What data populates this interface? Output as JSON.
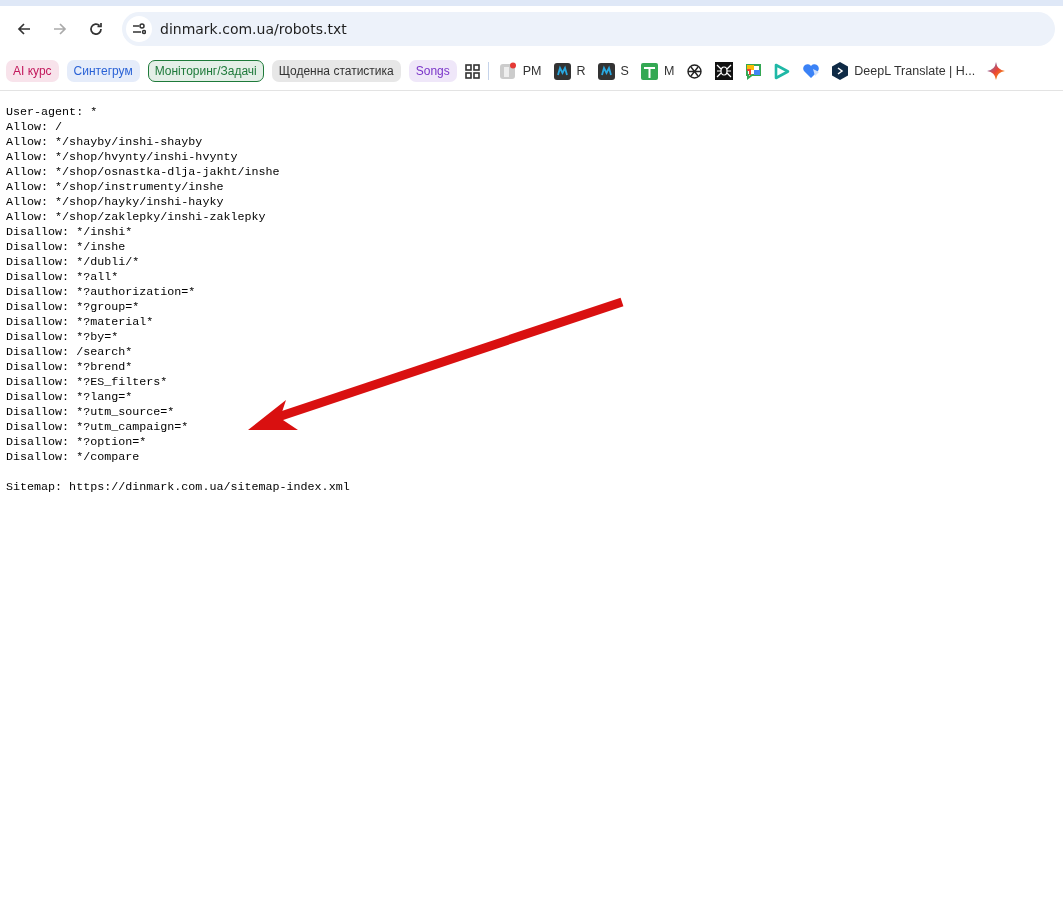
{
  "address_bar": {
    "url": "dinmark.com.ua/robots.txt"
  },
  "bookmarks": [
    {
      "kind": "chip",
      "label": "AI курс",
      "color": "#c2185b",
      "outlined": false
    },
    {
      "kind": "chip",
      "label": "Синтегрум",
      "color": "#2a62d6",
      "outlined": false
    },
    {
      "kind": "chip",
      "label": "Моніторинг/Задачі",
      "color": "#1e7a3a",
      "outlined": true
    },
    {
      "kind": "chip",
      "label": "Щоденна статистика",
      "color": "#333333",
      "outlined": false
    },
    {
      "kind": "chip",
      "label": "Songs",
      "color": "#7b35c9",
      "outlined": false
    },
    {
      "kind": "apps"
    },
    {
      "kind": "divider"
    },
    {
      "kind": "badge-tile",
      "label": "PM"
    },
    {
      "kind": "dark-tile",
      "label": "R"
    },
    {
      "kind": "dark-tile",
      "label": "S"
    },
    {
      "kind": "green-tile",
      "label": "M"
    },
    {
      "kind": "knot"
    },
    {
      "kind": "spider"
    },
    {
      "kind": "chat"
    },
    {
      "kind": "play"
    },
    {
      "kind": "heart"
    },
    {
      "kind": "hexagon",
      "label": "DeepL Translate | H..."
    },
    {
      "kind": "spark"
    }
  ],
  "document": {
    "rules": [
      "User-agent: *",
      "Allow: /",
      "Allow: */shayby/inshi-shayby",
      "Allow: */shop/hvynty/inshi-hvynty",
      "Allow: */shop/osnastka-dlja-jakht/inshe",
      "Allow: */shop/instrumenty/inshe",
      "Allow: */shop/hayky/inshi-hayky",
      "Allow: */shop/zaklepky/inshi-zaklepky",
      "Disallow: */inshi*",
      "Disallow: */inshe",
      "Disallow: */dubli/*",
      "Disallow: *?all*",
      "Disallow: *?authorization=*",
      "Disallow: *?group=*",
      "Disallow: *?material*",
      "Disallow: *?by=*",
      "Disallow: /search*",
      "Disallow: *?brend*",
      "Disallow: *?ES_filters*",
      "Disallow: *?lang=*",
      "Disallow: *?utm_source=*",
      "Disallow: *?utm_campaign=*",
      "Disallow: *?option=*",
      "Disallow: */compare"
    ],
    "sitemap": "Sitemap: https://dinmark.com.ua/sitemap-index.xml"
  }
}
